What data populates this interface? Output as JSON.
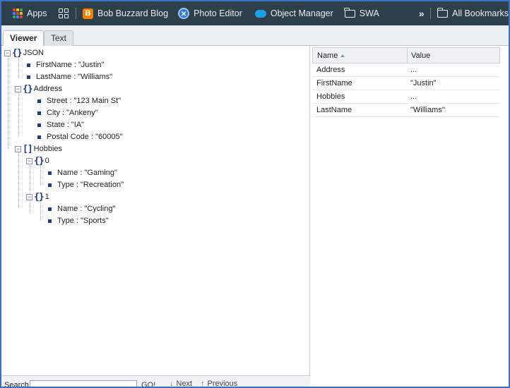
{
  "bookmarks_bar": {
    "apps_label": "Apps",
    "items": [
      {
        "label": "Bob Buzzard Blog",
        "icon": "blogger-icon"
      },
      {
        "label": "Photo Editor",
        "icon": "photo-editor-icon"
      },
      {
        "label": "Object Manager",
        "icon": "salesforce-cloud-icon"
      },
      {
        "label": "SWA",
        "icon": "folder-icon"
      }
    ],
    "overflow_label": "»",
    "all_bookmarks_label": "All Bookmarks"
  },
  "tabs": [
    {
      "label": "Viewer",
      "active": true
    },
    {
      "label": "Text",
      "active": false
    }
  ],
  "tree": {
    "root": "JSON",
    "first_name": "FirstName : \"Justin\"",
    "last_name": "LastName : \"Williams\"",
    "address": "Address",
    "street": "Street : \"123 Main St\"",
    "city": "City : \"Ankeny\"",
    "state": "State : \"IA\"",
    "postal": "Postal Code : \"60005\"",
    "hobbies": "Hobbies",
    "h0": "0",
    "h0_name": "Name : \"Gaming\"",
    "h0_type": "Type : \"Recreation\"",
    "h1": "1",
    "h1_name": "Name : \"Cycling\"",
    "h1_type": "Type : \"Sports\""
  },
  "grid": {
    "col_name": "Name",
    "col_value": "Value",
    "rows": [
      {
        "name": "Address",
        "value": "..."
      },
      {
        "name": "FirstName",
        "value": "\"Justin\""
      },
      {
        "name": "Hobbies",
        "value": "..."
      },
      {
        "name": "LastName",
        "value": "\"Williams\""
      }
    ]
  },
  "footer": {
    "search_label": "Search:",
    "search_value": "",
    "go_label": "GO!",
    "next_label": "Next",
    "previous_label": "Previous"
  },
  "colors": {
    "bookmarks_bg": "#2d3f4a",
    "tree_icon": "#1f3c8a",
    "frame_border": "#3a6fc4"
  }
}
